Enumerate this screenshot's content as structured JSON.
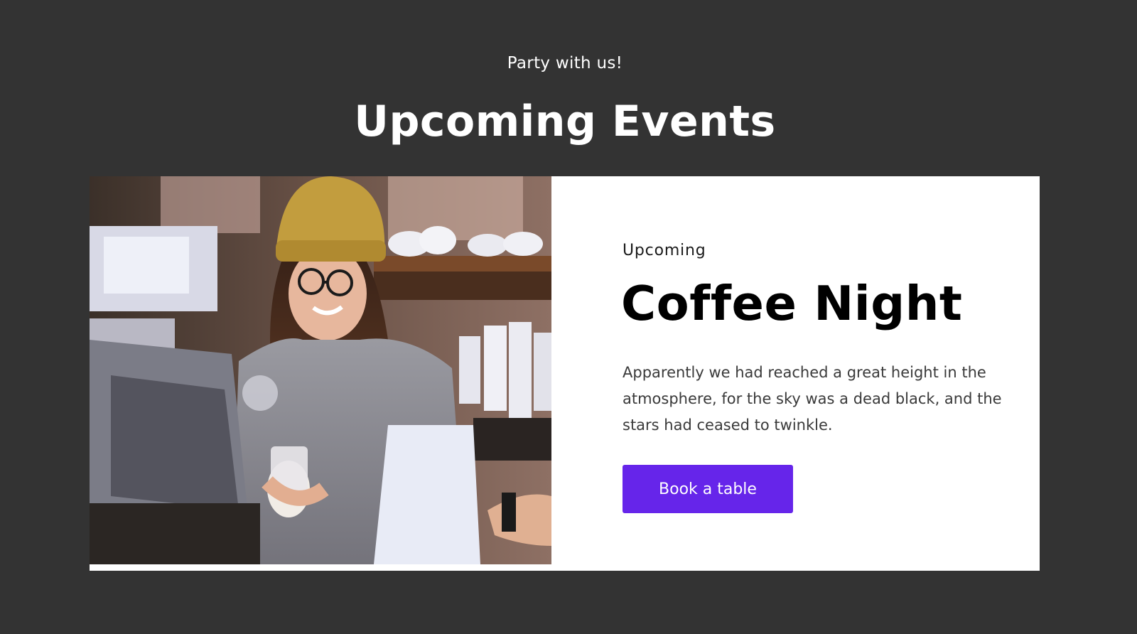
{
  "header": {
    "eyebrow": "Party with us!",
    "title": "Upcoming Events"
  },
  "event": {
    "tag": "Upcoming",
    "title": "Coffee Night",
    "description": "Apparently we had reached a great height in the atmosphere, for the sky was a dead black, and the stars had ceased to twinkle.",
    "button_label": "Book a table"
  },
  "colors": {
    "page_background": "#333333",
    "card_background": "#ffffff",
    "accent": "#6625ea"
  }
}
